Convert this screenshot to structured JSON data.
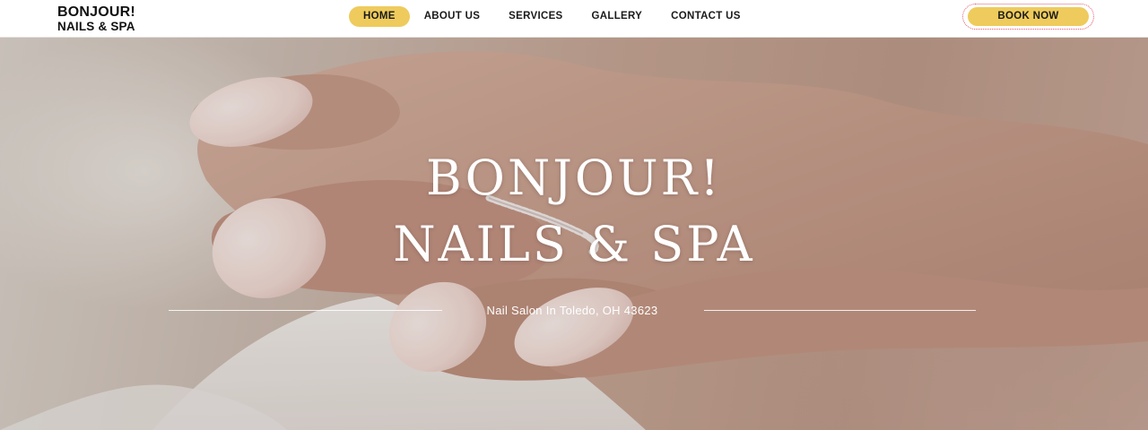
{
  "logo": {
    "line1": "BONJOUR!",
    "line2": "NAILS & SPA"
  },
  "nav": {
    "items": [
      {
        "label": "HOME",
        "active": true
      },
      {
        "label": "ABOUT US"
      },
      {
        "label": "SERVICES"
      },
      {
        "label": "GALLERY"
      },
      {
        "label": "CONTACT US"
      }
    ]
  },
  "cta": {
    "label": "BOOK NOW"
  },
  "hero": {
    "title_line1": "BONJOUR!",
    "title_line2": "NAILS & SPA",
    "tagline": "Nail Salon In Toledo, OH 43623"
  },
  "colors": {
    "accent_yellow": "#eecb5c",
    "button_outline": "#e2566c",
    "hero_text": "#ffffff"
  }
}
